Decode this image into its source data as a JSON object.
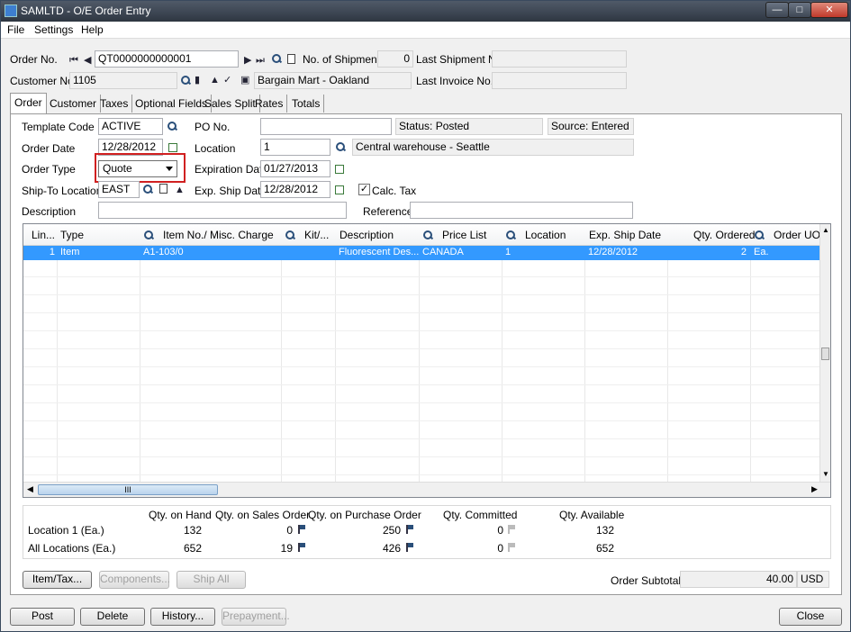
{
  "window": {
    "title": "SAMLTD - O/E Order Entry"
  },
  "menu": {
    "file": "File",
    "settings": "Settings",
    "help": "Help"
  },
  "header": {
    "order_no_label": "Order No.",
    "order_no": "QT0000000000001",
    "no_shipments_label": "No. of Shipments",
    "no_shipments": "0",
    "last_shipment_label": "Last Shipment No.",
    "last_shipment": "",
    "customer_no_label": "Customer No.",
    "customer_no": "1105",
    "customer_name": "Bargain Mart - Oakland",
    "last_invoice_label": "Last Invoice No.",
    "last_invoice": ""
  },
  "tabs": [
    "Order",
    "Customer",
    "Taxes",
    "Optional Fields",
    "Sales Split",
    "Rates",
    "Totals"
  ],
  "order": {
    "template_code_label": "Template Code",
    "template_code": "ACTIVE",
    "po_no_label": "PO No.",
    "po_no": "",
    "status": "Status: Posted",
    "source": "Source: Entered",
    "order_date_label": "Order Date",
    "order_date": "12/28/2012",
    "location_label": "Location",
    "location": "1",
    "location_desc": "Central warehouse - Seattle",
    "order_type_label": "Order Type",
    "order_type": "Quote",
    "expiration_date_label": "Expiration Date",
    "expiration_date": "01/27/2013",
    "ship_to_label": "Ship-To Location",
    "ship_to": "EAST",
    "exp_ship_date_label": "Exp. Ship Date",
    "exp_ship_date": "12/28/2012",
    "calc_tax_label": "Calc. Tax",
    "calc_tax": true,
    "description_label": "Description",
    "description": "",
    "reference_label": "Reference",
    "reference": ""
  },
  "grid": {
    "columns": [
      "Lin...",
      "Type",
      "Item No./ Misc. Charge",
      "Kit/...",
      "Description",
      "Price List",
      "Location",
      "Exp. Ship Date",
      "Qty. Ordered",
      "Order UOM"
    ],
    "rows": [
      {
        "line": "1",
        "type": "Item",
        "item": "A1-103/0",
        "kit": "",
        "description": "Fluorescent Des...",
        "price_list": "CANADA",
        "location": "1",
        "exp_ship": "12/28/2012",
        "qty": "2",
        "uom": "Ea."
      }
    ],
    "scroll_thumb_label": "III"
  },
  "summary": {
    "headers": [
      "Qty. on Hand",
      "Qty. on Sales Order",
      "Qty. on Purchase Order",
      "Qty. Committed",
      "Qty. Available"
    ],
    "rows": [
      {
        "label": "Location  1 (Ea.)",
        "on_hand": "132",
        "sales_order": "0",
        "purchase_order": "250",
        "committed": "0",
        "available": "132"
      },
      {
        "label": "All Locations (Ea.)",
        "on_hand": "652",
        "sales_order": "19",
        "purchase_order": "426",
        "committed": "0",
        "available": "652"
      }
    ]
  },
  "buttons": {
    "item_tax": "Item/Tax...",
    "components": "Components...",
    "ship_all": "Ship All",
    "post": "Post",
    "delete": "Delete",
    "history": "History...",
    "prepayment": "Prepayment...",
    "close": "Close"
  },
  "totals": {
    "subtotal_label": "Order Subtotal",
    "subtotal": "40.00",
    "currency": "USD"
  },
  "colors": {
    "selection": "#3399ff",
    "highlight_box": "#d02020"
  }
}
